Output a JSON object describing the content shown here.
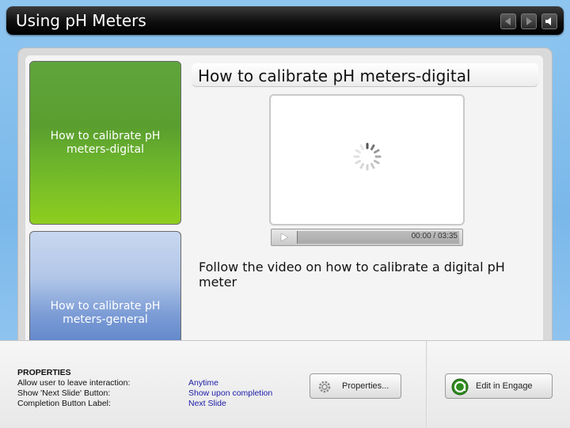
{
  "header": {
    "title": "Using pH Meters",
    "prev_icon": "prev-arrow-icon",
    "next_icon": "next-arrow-icon",
    "audio_icon": "speaker-icon"
  },
  "tabs": [
    {
      "label": "How to calibrate pH meters-digital",
      "active": true
    },
    {
      "label": "How to calibrate pH meters-general",
      "active": false
    }
  ],
  "content": {
    "title": "How to calibrate pH meters-digital",
    "video": {
      "time": "00:00 / 03:35"
    },
    "description": "Follow the video on how to calibrate a digital pH meter"
  },
  "properties": {
    "heading": "PROPERTIES",
    "rows": [
      {
        "label": "Allow user to leave interaction:",
        "value": "Anytime"
      },
      {
        "label": "Show 'Next Slide' Button:",
        "value": "Show upon completion"
      },
      {
        "label": "Completion Button Label:",
        "value": "Next Slide"
      }
    ],
    "properties_button": "Properties...",
    "engage_button": "Edit in Engage"
  },
  "colors": {
    "active_tab": "#6ab32c",
    "inactive_tab": "#7d9dd6",
    "value_text": "#1a1aa8",
    "title_bar": "#000000"
  }
}
